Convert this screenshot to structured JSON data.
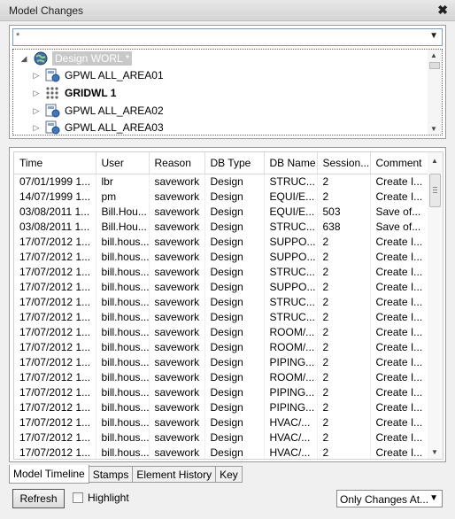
{
  "window": {
    "title": "Model Changes",
    "close_glyph": "✖"
  },
  "filter_combo": {
    "value": "*"
  },
  "tree": {
    "nodes": [
      {
        "label": "Design WORL *",
        "icon": "globe-icon",
        "expander": "◢"
      },
      {
        "label": "GPWL ALL_AREA01",
        "icon": "zone-icon",
        "expander": "▷"
      },
      {
        "label": "GRIDWL 1",
        "icon": "grid-icon",
        "expander": "▷"
      },
      {
        "label": "GPWL ALL_AREA02",
        "icon": "zone-icon",
        "expander": "▷"
      },
      {
        "label": "GPWL ALL_AREA03",
        "icon": "zone-icon",
        "expander": "▷"
      }
    ]
  },
  "grid": {
    "columns": [
      "Time",
      "User",
      "Reason",
      "DB Type",
      "DB Name",
      "Session...",
      "Comment"
    ],
    "rows": [
      [
        "07/01/1999 1...",
        "lbr",
        "savework",
        "Design",
        "STRUC...",
        "2",
        "Create I..."
      ],
      [
        "14/07/1999 1...",
        "pm",
        "savework",
        "Design",
        "EQUI/E...",
        "2",
        "Create I..."
      ],
      [
        "03/08/2011 1...",
        "Bill.Hou...",
        "savework",
        "Design",
        "EQUI/E...",
        "503",
        "Save of..."
      ],
      [
        "03/08/2011 1...",
        "Bill.Hou...",
        "savework",
        "Design",
        "STRUC...",
        "638",
        "Save of..."
      ],
      [
        "17/07/2012 1...",
        "bill.hous...",
        "savework",
        "Design",
        "SUPPO...",
        "2",
        "Create I..."
      ],
      [
        "17/07/2012 1...",
        "bill.hous...",
        "savework",
        "Design",
        "SUPPO...",
        "2",
        "Create I..."
      ],
      [
        "17/07/2012 1...",
        "bill.hous...",
        "savework",
        "Design",
        "STRUC...",
        "2",
        "Create I..."
      ],
      [
        "17/07/2012 1...",
        "bill.hous...",
        "savework",
        "Design",
        "SUPPO...",
        "2",
        "Create I..."
      ],
      [
        "17/07/2012 1...",
        "bill.hous...",
        "savework",
        "Design",
        "STRUC...",
        "2",
        "Create I..."
      ],
      [
        "17/07/2012 1...",
        "bill.hous...",
        "savework",
        "Design",
        "STRUC...",
        "2",
        "Create I..."
      ],
      [
        "17/07/2012 1...",
        "bill.hous...",
        "savework",
        "Design",
        "ROOM/...",
        "2",
        "Create I..."
      ],
      [
        "17/07/2012 1...",
        "bill.hous...",
        "savework",
        "Design",
        "ROOM/...",
        "2",
        "Create I..."
      ],
      [
        "17/07/2012 1...",
        "bill.hous...",
        "savework",
        "Design",
        "PIPING...",
        "2",
        "Create I..."
      ],
      [
        "17/07/2012 1...",
        "bill.hous...",
        "savework",
        "Design",
        "ROOM/...",
        "2",
        "Create I..."
      ],
      [
        "17/07/2012 1...",
        "bill.hous...",
        "savework",
        "Design",
        "PIPING...",
        "2",
        "Create I..."
      ],
      [
        "17/07/2012 1...",
        "bill.hous...",
        "savework",
        "Design",
        "PIPING...",
        "2",
        "Create I..."
      ],
      [
        "17/07/2012 1...",
        "bill.hous...",
        "savework",
        "Design",
        "HVAC/...",
        "2",
        "Create I..."
      ],
      [
        "17/07/2012 1...",
        "bill.hous...",
        "savework",
        "Design",
        "HVAC/...",
        "2",
        "Create I..."
      ],
      [
        "17/07/2012 1...",
        "bill.hous...",
        "savework",
        "Design",
        "HVAC/...",
        "2",
        "Create I..."
      ]
    ]
  },
  "tabs": [
    "Model Timeline",
    "Stamps",
    "Element History",
    "Key"
  ],
  "active_tab": "Model Timeline",
  "bottom": {
    "refresh_label": "Refresh",
    "highlight_label": "Highlight",
    "highlight_checked": false,
    "filter_select_value": "Only Changes At..."
  }
}
